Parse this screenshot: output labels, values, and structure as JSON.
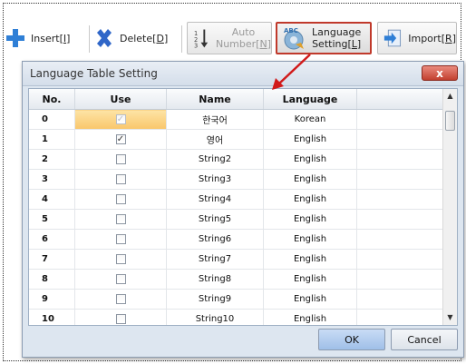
{
  "toolbar": {
    "insert": {
      "label": "Insert",
      "key": "I"
    },
    "delete": {
      "label": "Delete",
      "key": "D"
    },
    "auto_number": {
      "line1": "Auto",
      "line2": "Number",
      "key": "N"
    },
    "language_setting": {
      "line1": "Language",
      "line2": "Setting",
      "key": "L"
    },
    "import": {
      "label": "Import",
      "key": "R"
    }
  },
  "dialog": {
    "title": "Language Table Setting",
    "close_symbol": "x",
    "columns": [
      "No.",
      "Use",
      "Name",
      "Language"
    ],
    "rows": [
      {
        "no": "0",
        "use": true,
        "enabled": false,
        "name": "한국어",
        "language": "Korean"
      },
      {
        "no": "1",
        "use": true,
        "enabled": true,
        "name": "영어",
        "language": "English"
      },
      {
        "no": "2",
        "use": false,
        "enabled": true,
        "name": "String2",
        "language": "English"
      },
      {
        "no": "3",
        "use": false,
        "enabled": true,
        "name": "String3",
        "language": "English"
      },
      {
        "no": "4",
        "use": false,
        "enabled": true,
        "name": "String4",
        "language": "English"
      },
      {
        "no": "5",
        "use": false,
        "enabled": true,
        "name": "String5",
        "language": "English"
      },
      {
        "no": "6",
        "use": false,
        "enabled": true,
        "name": "String6",
        "language": "English"
      },
      {
        "no": "7",
        "use": false,
        "enabled": true,
        "name": "String7",
        "language": "English"
      },
      {
        "no": "8",
        "use": false,
        "enabled": true,
        "name": "String8",
        "language": "English"
      },
      {
        "no": "9",
        "use": false,
        "enabled": true,
        "name": "String9",
        "language": "English"
      },
      {
        "no": "10",
        "use": false,
        "enabled": true,
        "name": "String10",
        "language": "English"
      }
    ],
    "ok_label": "OK",
    "cancel_label": "Cancel"
  },
  "colors": {
    "highlight_border": "#c0392b",
    "selected_cell": "#f9c66b",
    "ok_button": "#9fbfe8",
    "close_button": "#c2402f"
  }
}
